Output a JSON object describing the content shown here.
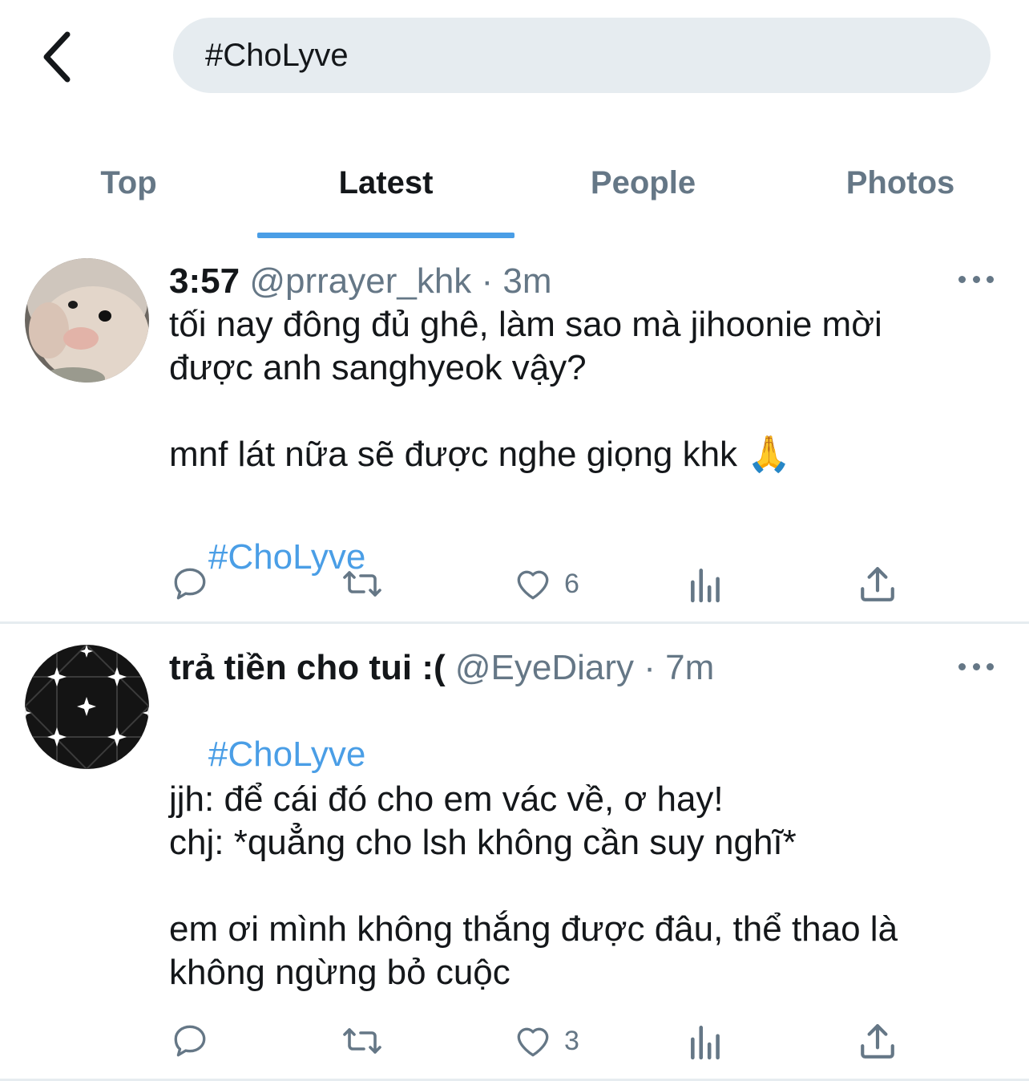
{
  "header": {
    "back_icon": "chevron-left-icon",
    "search_value": "#ChoLyve"
  },
  "tabs": [
    {
      "label": "Top",
      "active": false
    },
    {
      "label": "Latest",
      "active": true
    },
    {
      "label": "People",
      "active": false
    },
    {
      "label": "Photos",
      "active": false
    }
  ],
  "colors": {
    "accent": "#4a9ee6",
    "muted": "#657786",
    "text": "#14171a",
    "search_bg": "#e6ecf0"
  },
  "tweets": [
    {
      "name": "3:57",
      "handle": "@prrayer_khk · 3m",
      "text_lines": [
        "tối nay đông đủ ghê, làm sao mà jihoonie mời\nđược anh sanghyeok vậy?\n\nmnf lát nữa sẽ được nghe giọng khk 🙏"
      ],
      "hashtag": "#ChoLyve",
      "likes": "6"
    },
    {
      "name": "trả tiền cho tui :(",
      "handle": "@EyeDiary · 7m",
      "hashtag": "#ChoLyve",
      "text": "jjh: để cái đó cho em vác về, ơ hay!\nchj: *quẳng cho lsh không cần suy nghĩ*\n\nem ơi mình không thắng được đâu, thể thao là\nkhông ngừng bỏ cuộc",
      "likes": "3"
    }
  ]
}
